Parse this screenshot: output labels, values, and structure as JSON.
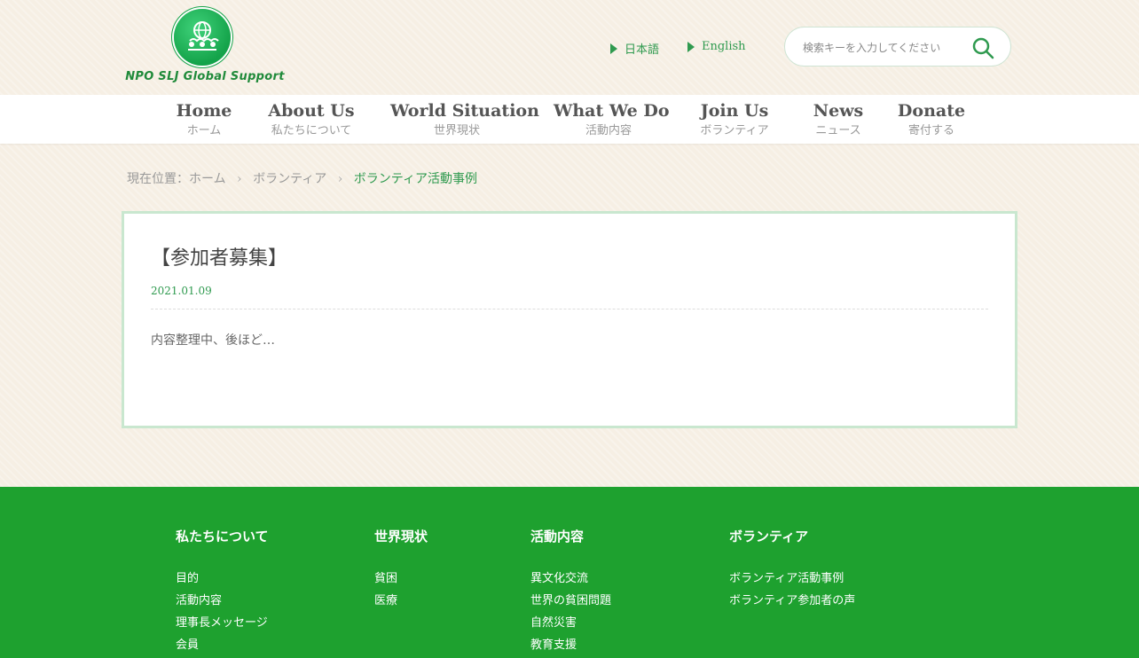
{
  "header": {
    "logo_text": "NPO SLJ Global Support",
    "languages": [
      {
        "label": "日本語"
      },
      {
        "label": "English"
      }
    ],
    "search": {
      "placeholder": "検索キーを入力してください"
    }
  },
  "nav": {
    "items": [
      {
        "en": "Home",
        "jp": "ホーム"
      },
      {
        "en": "About Us",
        "jp": "私たちについて"
      },
      {
        "en": "World Situation",
        "jp": "世界現状"
      },
      {
        "en": "What We Do",
        "jp": "活動内容"
      },
      {
        "en": "Join Us",
        "jp": "ボランティア"
      },
      {
        "en": "News",
        "jp": "ニュース"
      },
      {
        "en": "Donate",
        "jp": "寄付する"
      }
    ]
  },
  "breadcrumb": {
    "prefix": "現在位置：",
    "items": [
      "ホーム",
      "ボランティア",
      "ボランティア活動事例"
    ]
  },
  "article": {
    "title": "【参加者募集】",
    "date": "2021.01.09",
    "body": "内容整理中、後ほど…"
  },
  "footer": {
    "columns": [
      {
        "heading": "私たちについて",
        "links": [
          "目的",
          "活動内容",
          "理事長メッセージ",
          "会員"
        ]
      },
      {
        "heading": "世界現状",
        "links": [
          "貧困",
          "医療"
        ]
      },
      {
        "heading": "活動内容",
        "links": [
          "異文化交流",
          "世界の貧困問題",
          "自然災害",
          "教育支援"
        ]
      },
      {
        "heading": "ボランティア",
        "links": [
          "ボランティア活動事例",
          "ボランティア参加者の声"
        ]
      }
    ]
  },
  "colors": {
    "accent": "#2f9a4f",
    "footer_bg": "#1ea12f",
    "card_border": "#c9e7cf"
  }
}
